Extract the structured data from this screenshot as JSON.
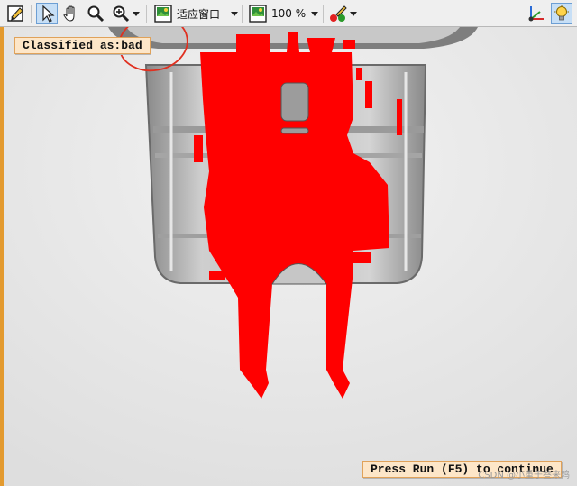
{
  "toolbar": {
    "zoom_fit_text": "适应窗口",
    "zoom_percent_text": "100 %"
  },
  "overlay": {
    "classified_text": "Classified as:bad",
    "press_run_text": "Press Run (F5) to continue"
  },
  "watermark": "CSDN @小重于叁来鸡",
  "colors": {
    "segmentation": "#ff0000",
    "label_bg": "#fde6c8",
    "label_border": "#e0a25a",
    "annotation_circle": "#e03020",
    "left_edge": "#e39a2f"
  },
  "icons": [
    "edit-icon",
    "pointer-icon",
    "hand-icon",
    "magnifier-icon",
    "zoom-in-icon",
    "image-fit-icon",
    "image-zoom-icon",
    "color-paint-icon",
    "axes-icon",
    "lightbulb-icon"
  ]
}
